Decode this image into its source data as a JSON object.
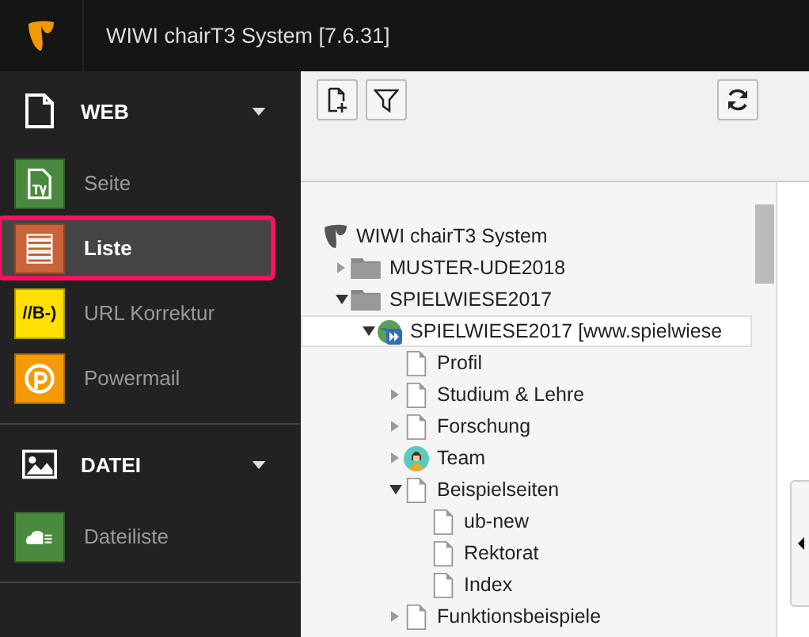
{
  "topbar": {
    "title": "WIWI chairT3 System [7.6.31]"
  },
  "sidebar": {
    "groups": [
      {
        "label": "WEB",
        "kind": "page",
        "expanded": true,
        "items": [
          {
            "label": "Seite",
            "kind": "tv",
            "color": "#4a8a3e",
            "selected": false
          },
          {
            "label": "Liste",
            "kind": "list",
            "color": "#c8633a",
            "selected": true
          },
          {
            "label": "URL Korrektur",
            "kind": "text",
            "badge": "//B-)",
            "color": "#ffe000",
            "selected": false
          },
          {
            "label": "Powermail",
            "kind": "powermail",
            "color": "#f39a05",
            "selected": false
          }
        ]
      },
      {
        "label": "DATEI",
        "kind": "image",
        "expanded": true,
        "items": [
          {
            "label": "Dateiliste",
            "kind": "cloud",
            "color": "#4a8a3e",
            "selected": false
          }
        ]
      }
    ]
  },
  "toolbar": {
    "buttons": [
      {
        "kind": "new-page"
      },
      {
        "kind": "filter"
      }
    ],
    "right_buttons": [
      {
        "kind": "refresh"
      }
    ]
  },
  "tree": [
    {
      "label": "WIWI chairT3 System",
      "kind": "root",
      "selected": false,
      "children": [
        {
          "label": "MUSTER-UDE2018",
          "kind": "folder",
          "expanded": false,
          "selected": false
        },
        {
          "label": "SPIELWIESE2017",
          "kind": "folder",
          "expanded": true,
          "selected": false,
          "children": [
            {
              "label": "SPIELWIESE2017 [www.spielwiese",
              "kind": "site",
              "expanded": true,
              "selected": true,
              "children": [
                {
                  "label": "Profil",
                  "kind": "page",
                  "selected": false
                },
                {
                  "label": "Studium & Lehre",
                  "kind": "page",
                  "expanded": false,
                  "selected": false
                },
                {
                  "label": "Forschung",
                  "kind": "page",
                  "expanded": false,
                  "selected": false
                },
                {
                  "label": "Team",
                  "kind": "person",
                  "expanded": false,
                  "selected": false
                },
                {
                  "label": "Beispielseiten",
                  "kind": "page",
                  "expanded": true,
                  "selected": false,
                  "children": [
                    {
                      "label": "ub-new",
                      "kind": "page",
                      "selected": false
                    },
                    {
                      "label": "Rektorat",
                      "kind": "page",
                      "selected": false
                    },
                    {
                      "label": "Index",
                      "kind": "page",
                      "selected": false
                    }
                  ]
                },
                {
                  "label": "Funktionsbeispiele",
                  "kind": "page",
                  "expanded": false,
                  "selected": false
                }
              ]
            }
          ]
        }
      ]
    }
  ]
}
